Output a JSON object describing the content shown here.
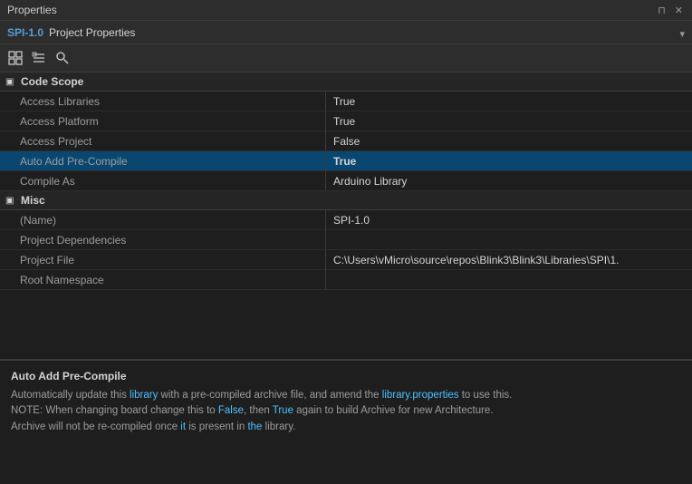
{
  "titlebar": {
    "title": "Properties",
    "btn_pin": "⊓",
    "btn_close": "✕",
    "btn_dropdown": "▾"
  },
  "tab": {
    "spi": "SPI-1.0",
    "label": "Project Properties",
    "dropdown": "▾"
  },
  "toolbar": {
    "btn1_icon": "⊞",
    "btn2_icon": "⊟",
    "btn3_icon": "⌕"
  },
  "sections": [
    {
      "id": "code-scope",
      "label": "Code Scope",
      "collapsed": false,
      "properties": [
        {
          "name": "Access Libraries",
          "value": "True",
          "bold": false
        },
        {
          "name": "Access Platform",
          "value": "True",
          "bold": false
        },
        {
          "name": "Access Project",
          "value": "False",
          "bold": false
        },
        {
          "name": "Auto Add Pre-Compile",
          "value": "True",
          "bold": true
        },
        {
          "name": "Compile As",
          "value": "Arduino Library",
          "bold": false
        }
      ]
    },
    {
      "id": "misc",
      "label": "Misc",
      "collapsed": false,
      "properties": [
        {
          "name": "(Name)",
          "value": "SPI-1.0",
          "bold": false
        },
        {
          "name": "Project Dependencies",
          "value": "",
          "bold": false
        },
        {
          "name": "Project File",
          "value": "C:\\Users\\vMicro\\source\\repos\\Blink3\\Blink3\\Libraries\\SPI\\1.",
          "bold": false
        },
        {
          "name": "Root Namespace",
          "value": "",
          "bold": false
        }
      ]
    }
  ],
  "description": {
    "title": "Auto Add Pre-Compile",
    "lines": [
      "Automatically update this library with a pre-compiled archive file, and amend the library.properties to use this.",
      "NOTE: When changing board change this to False, then True again to build Archive for new Architecture.",
      "Archive will not be re-compiled once it is present in the library."
    ],
    "highlights": {
      "library": "library",
      "library_properties": "library.properties",
      "False": "False",
      "True": "True",
      "it": "it",
      "the": "the"
    }
  }
}
